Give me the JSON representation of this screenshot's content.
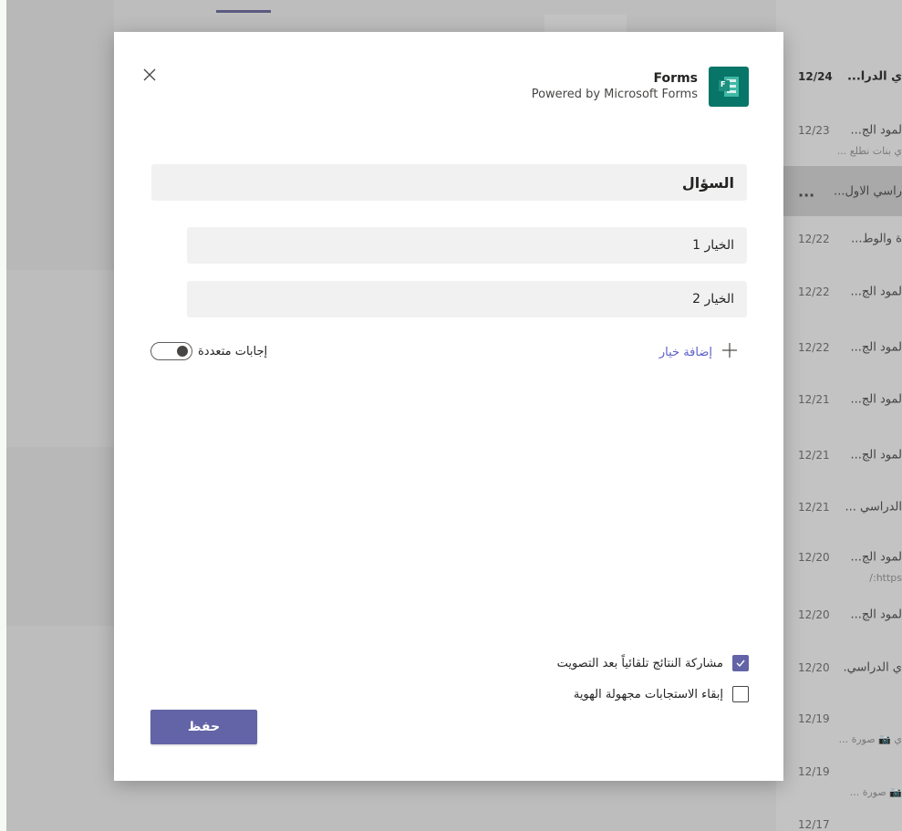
{
  "forms": {
    "title": "Forms",
    "subtitle": "Powered by Microsoft Forms",
    "logo_letter": "F",
    "accent": "#077568"
  },
  "poll": {
    "question_placeholder": "السؤال",
    "options": [
      "الخيار 1",
      "الخيار 2"
    ],
    "add_option_label": "إضافة خيار",
    "multiple_answers_label": "إجابات متعددة",
    "multiple_answers_on": true
  },
  "settings": {
    "share_results_label": "مشاركة النتائج تلقائياً بعد التصويت",
    "share_results_checked": true,
    "anonymous_label": "إبقاء الاستجابات مجهولة الهوية",
    "anonymous_checked": false
  },
  "save_label": "حفظ",
  "colors": {
    "primary": "#6264a7",
    "link": "#5b5fc7"
  },
  "chat_list": [
    {
      "date": "12/24",
      "title": "ي الدرا...",
      "bold": true
    },
    {
      "date": "12/23",
      "title": "لمود الج...",
      "sub": "ي بنات نطلع ..."
    },
    {
      "date": "",
      "title": "راسي الاول...",
      "selected": true
    },
    {
      "date": "12/22",
      "title": "ة والوط..."
    },
    {
      "date": "12/22",
      "title": "لمود الج..."
    },
    {
      "date": "12/22",
      "title": "لمود الج..."
    },
    {
      "date": "12/21",
      "title": "لمود الج..."
    },
    {
      "date": "12/21",
      "title": "لمود الج..."
    },
    {
      "date": "12/21",
      "title": "الدراسي ..."
    },
    {
      "date": "12/20",
      "title": "لمود الج...",
      "sub": "https:/"
    },
    {
      "date": "12/20",
      "title": "لمود الج..."
    },
    {
      "date": "12/20",
      "title": "ي الدراسي."
    },
    {
      "date": "12/19",
      "title": "",
      "sub": "ي 📷 صورة ..."
    },
    {
      "date": "12/19",
      "title": "",
      "sub": "📷 صورة ..."
    },
    {
      "date": "12/17",
      "title": ""
    }
  ]
}
